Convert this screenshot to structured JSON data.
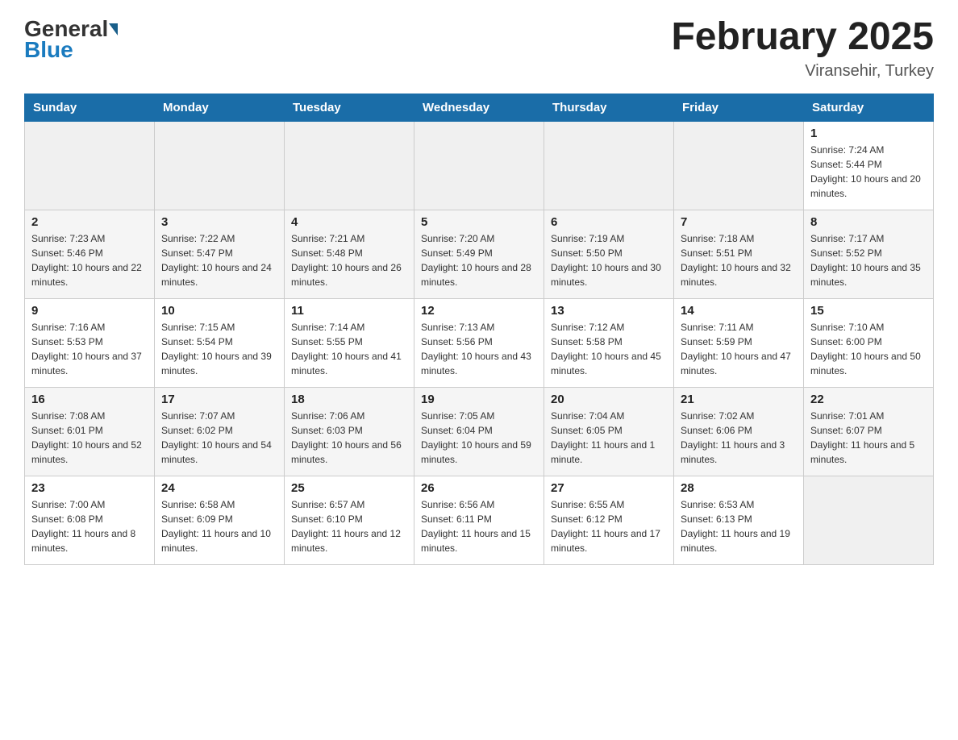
{
  "header": {
    "logo_general": "General",
    "logo_blue": "Blue",
    "title": "February 2025",
    "subtitle": "Viransehir, Turkey"
  },
  "days_of_week": [
    "Sunday",
    "Monday",
    "Tuesday",
    "Wednesday",
    "Thursday",
    "Friday",
    "Saturday"
  ],
  "weeks": [
    [
      {
        "day": "",
        "info": ""
      },
      {
        "day": "",
        "info": ""
      },
      {
        "day": "",
        "info": ""
      },
      {
        "day": "",
        "info": ""
      },
      {
        "day": "",
        "info": ""
      },
      {
        "day": "",
        "info": ""
      },
      {
        "day": "1",
        "info": "Sunrise: 7:24 AM\nSunset: 5:44 PM\nDaylight: 10 hours and 20 minutes."
      }
    ],
    [
      {
        "day": "2",
        "info": "Sunrise: 7:23 AM\nSunset: 5:46 PM\nDaylight: 10 hours and 22 minutes."
      },
      {
        "day": "3",
        "info": "Sunrise: 7:22 AM\nSunset: 5:47 PM\nDaylight: 10 hours and 24 minutes."
      },
      {
        "day": "4",
        "info": "Sunrise: 7:21 AM\nSunset: 5:48 PM\nDaylight: 10 hours and 26 minutes."
      },
      {
        "day": "5",
        "info": "Sunrise: 7:20 AM\nSunset: 5:49 PM\nDaylight: 10 hours and 28 minutes."
      },
      {
        "day": "6",
        "info": "Sunrise: 7:19 AM\nSunset: 5:50 PM\nDaylight: 10 hours and 30 minutes."
      },
      {
        "day": "7",
        "info": "Sunrise: 7:18 AM\nSunset: 5:51 PM\nDaylight: 10 hours and 32 minutes."
      },
      {
        "day": "8",
        "info": "Sunrise: 7:17 AM\nSunset: 5:52 PM\nDaylight: 10 hours and 35 minutes."
      }
    ],
    [
      {
        "day": "9",
        "info": "Sunrise: 7:16 AM\nSunset: 5:53 PM\nDaylight: 10 hours and 37 minutes."
      },
      {
        "day": "10",
        "info": "Sunrise: 7:15 AM\nSunset: 5:54 PM\nDaylight: 10 hours and 39 minutes."
      },
      {
        "day": "11",
        "info": "Sunrise: 7:14 AM\nSunset: 5:55 PM\nDaylight: 10 hours and 41 minutes."
      },
      {
        "day": "12",
        "info": "Sunrise: 7:13 AM\nSunset: 5:56 PM\nDaylight: 10 hours and 43 minutes."
      },
      {
        "day": "13",
        "info": "Sunrise: 7:12 AM\nSunset: 5:58 PM\nDaylight: 10 hours and 45 minutes."
      },
      {
        "day": "14",
        "info": "Sunrise: 7:11 AM\nSunset: 5:59 PM\nDaylight: 10 hours and 47 minutes."
      },
      {
        "day": "15",
        "info": "Sunrise: 7:10 AM\nSunset: 6:00 PM\nDaylight: 10 hours and 50 minutes."
      }
    ],
    [
      {
        "day": "16",
        "info": "Sunrise: 7:08 AM\nSunset: 6:01 PM\nDaylight: 10 hours and 52 minutes."
      },
      {
        "day": "17",
        "info": "Sunrise: 7:07 AM\nSunset: 6:02 PM\nDaylight: 10 hours and 54 minutes."
      },
      {
        "day": "18",
        "info": "Sunrise: 7:06 AM\nSunset: 6:03 PM\nDaylight: 10 hours and 56 minutes."
      },
      {
        "day": "19",
        "info": "Sunrise: 7:05 AM\nSunset: 6:04 PM\nDaylight: 10 hours and 59 minutes."
      },
      {
        "day": "20",
        "info": "Sunrise: 7:04 AM\nSunset: 6:05 PM\nDaylight: 11 hours and 1 minute."
      },
      {
        "day": "21",
        "info": "Sunrise: 7:02 AM\nSunset: 6:06 PM\nDaylight: 11 hours and 3 minutes."
      },
      {
        "day": "22",
        "info": "Sunrise: 7:01 AM\nSunset: 6:07 PM\nDaylight: 11 hours and 5 minutes."
      }
    ],
    [
      {
        "day": "23",
        "info": "Sunrise: 7:00 AM\nSunset: 6:08 PM\nDaylight: 11 hours and 8 minutes."
      },
      {
        "day": "24",
        "info": "Sunrise: 6:58 AM\nSunset: 6:09 PM\nDaylight: 11 hours and 10 minutes."
      },
      {
        "day": "25",
        "info": "Sunrise: 6:57 AM\nSunset: 6:10 PM\nDaylight: 11 hours and 12 minutes."
      },
      {
        "day": "26",
        "info": "Sunrise: 6:56 AM\nSunset: 6:11 PM\nDaylight: 11 hours and 15 minutes."
      },
      {
        "day": "27",
        "info": "Sunrise: 6:55 AM\nSunset: 6:12 PM\nDaylight: 11 hours and 17 minutes."
      },
      {
        "day": "28",
        "info": "Sunrise: 6:53 AM\nSunset: 6:13 PM\nDaylight: 11 hours and 19 minutes."
      },
      {
        "day": "",
        "info": ""
      }
    ]
  ]
}
